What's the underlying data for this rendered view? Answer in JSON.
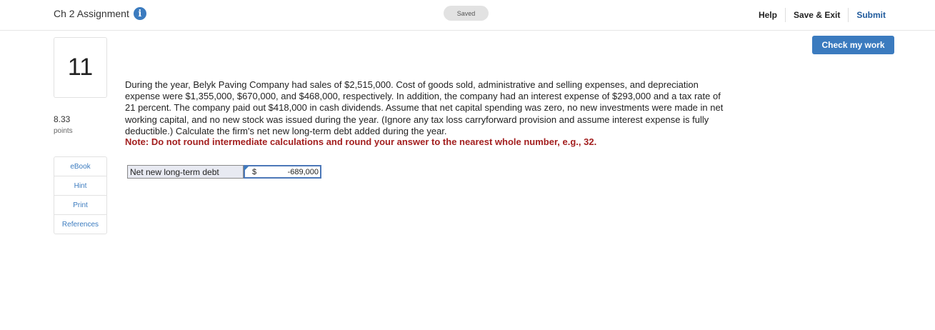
{
  "header": {
    "assignment_title": "Ch 2 Assignment",
    "info_icon": "i",
    "status": "Saved",
    "links": {
      "help": "Help",
      "save_exit": "Save & Exit",
      "submit": "Submit"
    }
  },
  "check_button": "Check my work",
  "question": {
    "number": "11",
    "points_value": "8.33",
    "points_label": "points",
    "text": "During the year, Belyk Paving Company had sales of $2,515,000. Cost of goods sold, administrative and selling expenses, and depreciation expense were $1,355,000, $670,000, and $468,000, respectively. In addition, the company had an interest expense of $293,000 and a tax rate of 21 percent. The company paid out $418,000 in cash dividends. Assume that net capital spending was zero, no new investments were made in net working capital, and no new stock was issued during the year. (Ignore any tax loss carryforward provision and assume interest expense is fully deductible.) Calculate the firm's net new long-term debt added during the year.",
    "note": "Note: Do not round intermediate calculations and round your answer to the nearest whole number, e.g., 32."
  },
  "resources": [
    "eBook",
    "Hint",
    "Print",
    "References"
  ],
  "answer": {
    "label": "Net new long-term debt",
    "currency": "$",
    "value": "-689,000"
  }
}
